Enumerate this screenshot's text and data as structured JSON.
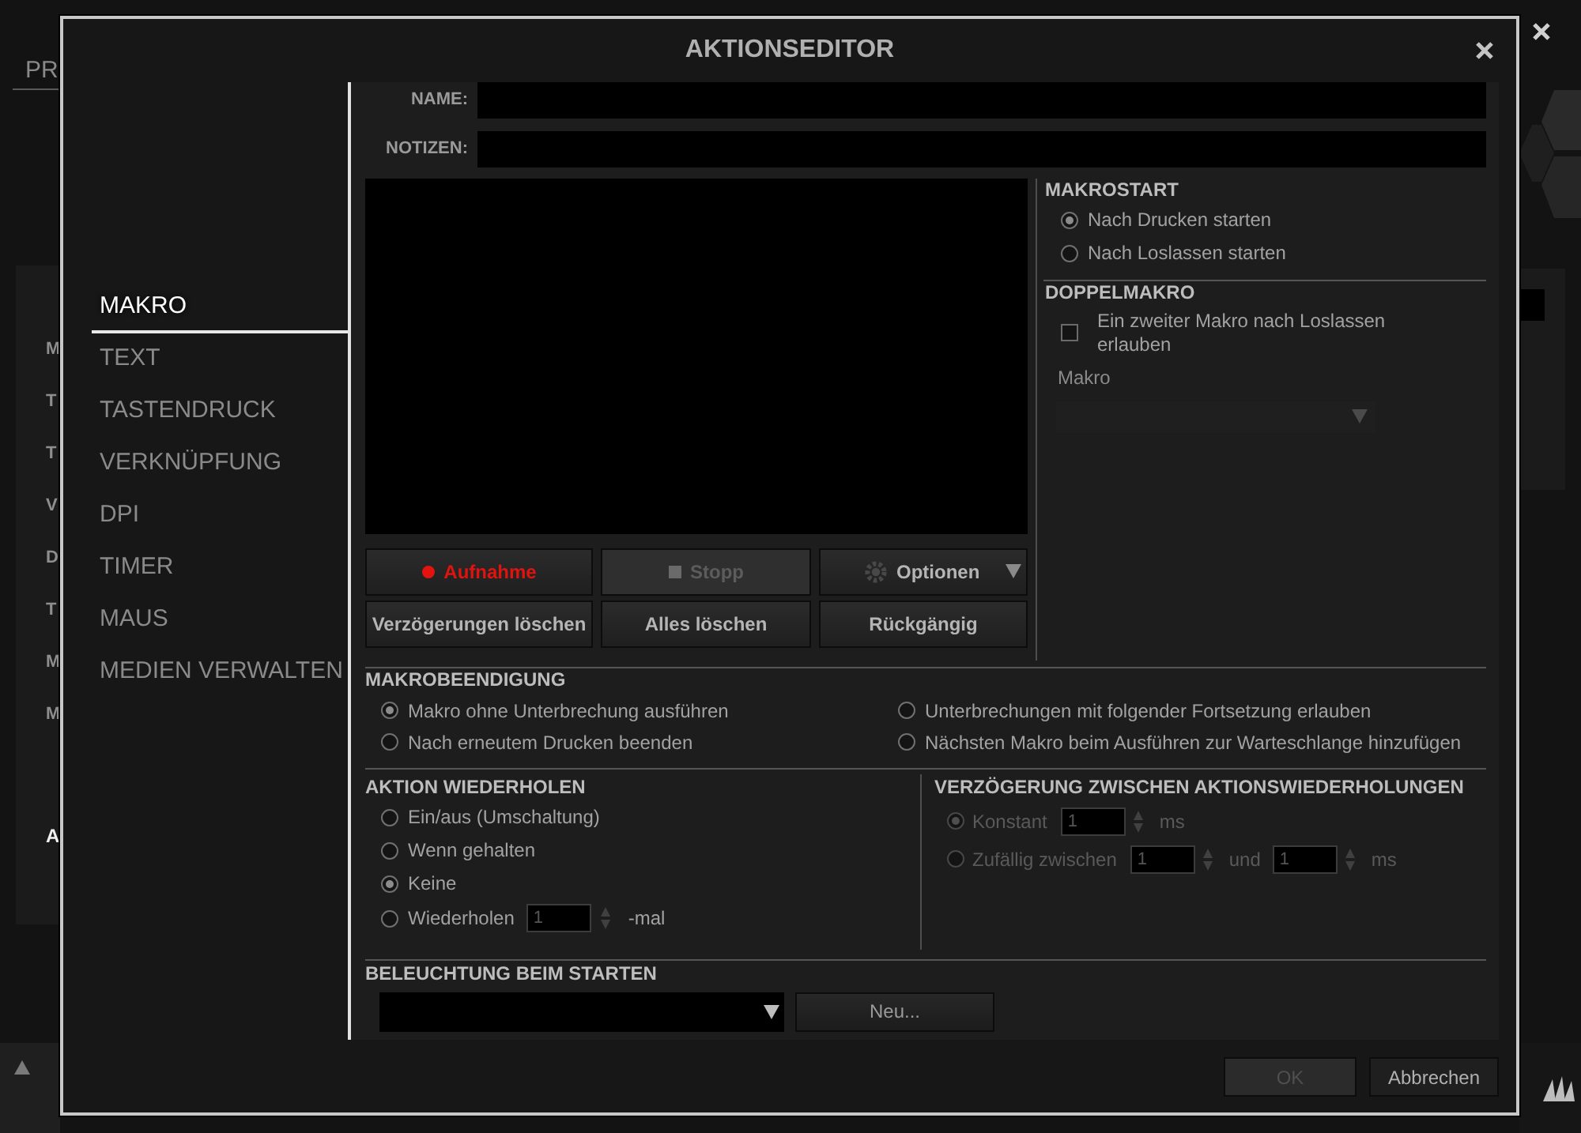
{
  "background": {
    "tab": "PR",
    "initials": [
      "M",
      "T",
      "T",
      "V",
      "D",
      "T",
      "M",
      "M"
    ],
    "section_initial": "A"
  },
  "window": {
    "title": "AKTIONSEDITOR"
  },
  "sidebar": {
    "items": [
      {
        "label": "MAKRO",
        "selected": true
      },
      {
        "label": "TEXT",
        "selected": false
      },
      {
        "label": "TASTENDRUCK",
        "selected": false
      },
      {
        "label": "VERKNÜPFUNG",
        "selected": false
      },
      {
        "label": "DPI",
        "selected": false
      },
      {
        "label": "TIMER",
        "selected": false
      },
      {
        "label": "MAUS",
        "selected": false
      },
      {
        "label": "MEDIEN VERWALTEN",
        "selected": false
      }
    ]
  },
  "fields": [
    {
      "label": "NAME:"
    },
    {
      "label": "NOTIZEN:"
    }
  ],
  "record_buttons": [
    {
      "label": "Aufnahme",
      "kind": "record",
      "disabled": false
    },
    {
      "label": "Stopp",
      "kind": "stop",
      "disabled": true
    },
    {
      "label": "Optionen",
      "kind": "options",
      "disabled": false
    }
  ],
  "edit_buttons": [
    {
      "label": "Verzögerungen löschen"
    },
    {
      "label": "Alles löschen"
    },
    {
      "label": "Rückgängig"
    }
  ],
  "macro_start": {
    "heading": "MAKROSTART",
    "options": [
      {
        "label": "Nach Drucken starten",
        "selected": true
      },
      {
        "label": "Nach Loslassen starten",
        "selected": false
      }
    ]
  },
  "double_macro": {
    "heading": "DOPPELMAKRO",
    "checkbox": {
      "label": "Ein zweiter Makro nach Loslassen erlauben",
      "checked": false
    },
    "dropdown": {
      "label": "Makro",
      "disabled": true
    }
  },
  "macro_end": {
    "heading": "MAKROBEENDIGUNG",
    "options": [
      {
        "label": "Makro ohne Unterbrechung ausführen",
        "selected": true
      },
      {
        "label": "Unterbrechungen mit folgender Fortsetzung erlauben",
        "selected": false
      },
      {
        "label": "Nach erneutem Drucken beenden",
        "selected": false
      },
      {
        "label": "Nächsten Makro beim Ausführen zur Warteschlange hinzufügen",
        "selected": false
      }
    ]
  },
  "repeat": {
    "heading": "AKTION WIEDERHOLEN",
    "options": [
      {
        "label": "Ein/aus (Umschaltung)",
        "selected": false
      },
      {
        "label": "Wenn gehalten",
        "selected": false
      },
      {
        "label": "Keine",
        "selected": true
      },
      {
        "label": "Wiederholen",
        "selected": false,
        "inputs": [
          {
            "value": "1",
            "after": "-mal"
          }
        ]
      }
    ]
  },
  "repeat_delay": {
    "heading": "VERZÖGERUNG ZWISCHEN AKTIONSWIEDERHOLUNGEN",
    "disabled": true,
    "options": [
      {
        "label": "Konstant",
        "selected": true,
        "inputs": [
          {
            "value": "1",
            "after": "ms"
          }
        ]
      },
      {
        "label": "Zufällig zwischen",
        "selected": false,
        "inputs": [
          {
            "value": "1",
            "after": "und"
          },
          {
            "value": "1",
            "after": "ms"
          }
        ]
      }
    ]
  },
  "lighting": {
    "heading": "BELEUCHTUNG BEIM STARTEN",
    "button": "Neu..."
  },
  "footer": {
    "buttons": [
      {
        "label": "OK",
        "disabled": true
      },
      {
        "label": "Abbrechen",
        "disabled": false
      }
    ]
  }
}
